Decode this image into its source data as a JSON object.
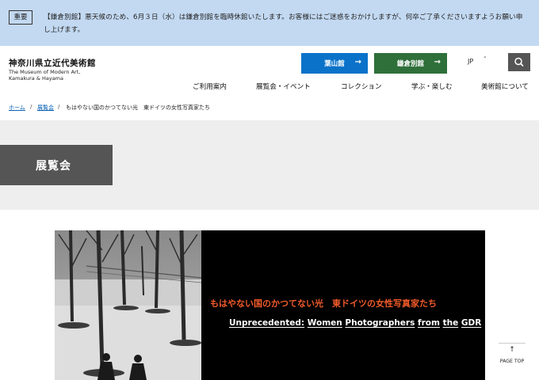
{
  "notice": {
    "badge": "重要",
    "text": "【鎌倉別館】悪天候のため、6月３日（水）は鎌倉別館を臨時休館いたします。お客様にはご迷惑をおかけしますが、何卒ご了承くださいますようお願い申し上げます。"
  },
  "header": {
    "logo_ja": "神奈川県立近代美術館",
    "logo_en_line1": "The Museum of Modern Art,",
    "logo_en_line2": "Kamakura & Hayama",
    "btn_hayama": "葉山館",
    "btn_kamakura": "鎌倉別館",
    "lang": "JP",
    "colors": {
      "hayama": "#0a72c9",
      "kamakura": "#2f6f3a"
    }
  },
  "nav": {
    "items": [
      "ご利用案内",
      "展覧会・イベント",
      "コレクション",
      "学ぶ・楽しむ",
      "美術館について"
    ]
  },
  "breadcrumb": {
    "home": "ホーム",
    "sep": "/",
    "exhibitions": "展覧会",
    "current": "もはやない国のかつてない光　東ドイツの女性写真家たち"
  },
  "section": {
    "title": "展覧会"
  },
  "hero": {
    "title_ja": "もはやない国のかつてない光　東ドイツの女性写真家たち",
    "title_en_words": [
      "Unprecedented:",
      "Women",
      "Photographers",
      "from",
      "the",
      "GDR"
    ],
    "accent_color": "#f05a2a"
  },
  "pagetop": {
    "label": "PAGE TOP"
  }
}
